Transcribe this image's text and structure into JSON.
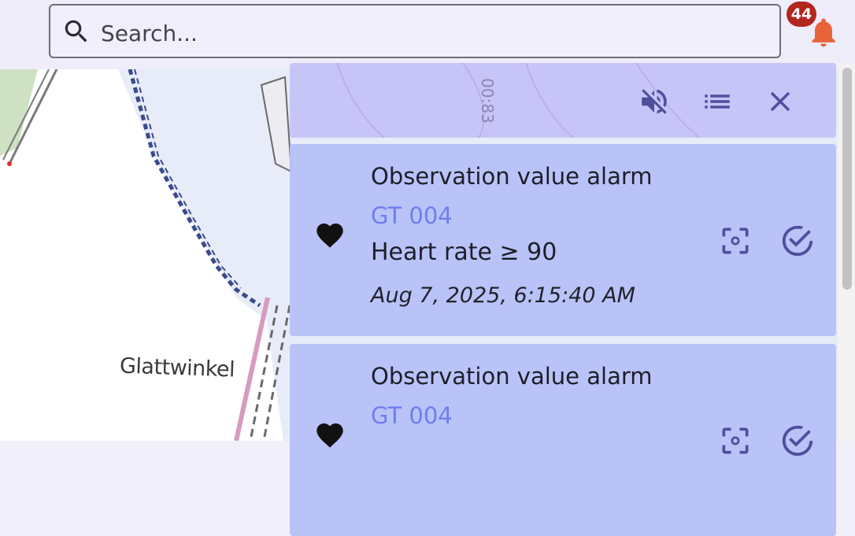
{
  "search": {
    "placeholder": "Search..."
  },
  "notifications": {
    "count": "44",
    "accent": "#e8623a",
    "badge_color": "#b3261e"
  },
  "map": {
    "place_label": "Glattwinkel",
    "road_label": "00:83"
  },
  "alarm_panel": {
    "header_icons": [
      "mute-icon",
      "list-icon",
      "close-icon"
    ],
    "cards": [
      {
        "title": "Observation value alarm",
        "device": "GT 004",
        "condition": "Heart rate ≥ 90",
        "timestamp": "Aug 7, 2025, 6:15:40 AM"
      },
      {
        "title": "Observation value alarm",
        "device": "GT 004",
        "condition": "",
        "timestamp": ""
      }
    ],
    "colors": {
      "header_bg": "#c3bff7",
      "card_bg": "#b7c1f7",
      "icon": "#4f4f9c",
      "device_text": "#6f7ef0"
    }
  }
}
